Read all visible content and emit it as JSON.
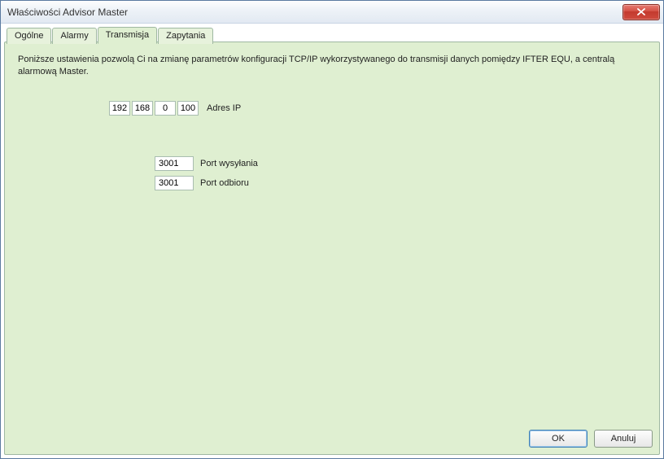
{
  "window": {
    "title": "Właściwości Advisor Master"
  },
  "tabs": {
    "ogolne": "Ogólne",
    "alarmy": "Alarmy",
    "transmisja": "Transmisja",
    "zapytania": "Zapytania"
  },
  "transmisja": {
    "description": "Poniższe ustawienia pozwolą Ci na zmianę parametrów konfiguracji TCP/IP wykorzystywanego do transmisji danych pomiędzy IFTER EQU, a centralą alarmową Master.",
    "ip": {
      "a": "192",
      "b": "168",
      "c": "0",
      "d": "100",
      "label": "Adres IP"
    },
    "port_send": {
      "value": "3001",
      "label": "Port wysyłania"
    },
    "port_recv": {
      "value": "3001",
      "label": "Port odbioru"
    }
  },
  "buttons": {
    "ok": "OK",
    "cancel": "Anuluj"
  }
}
